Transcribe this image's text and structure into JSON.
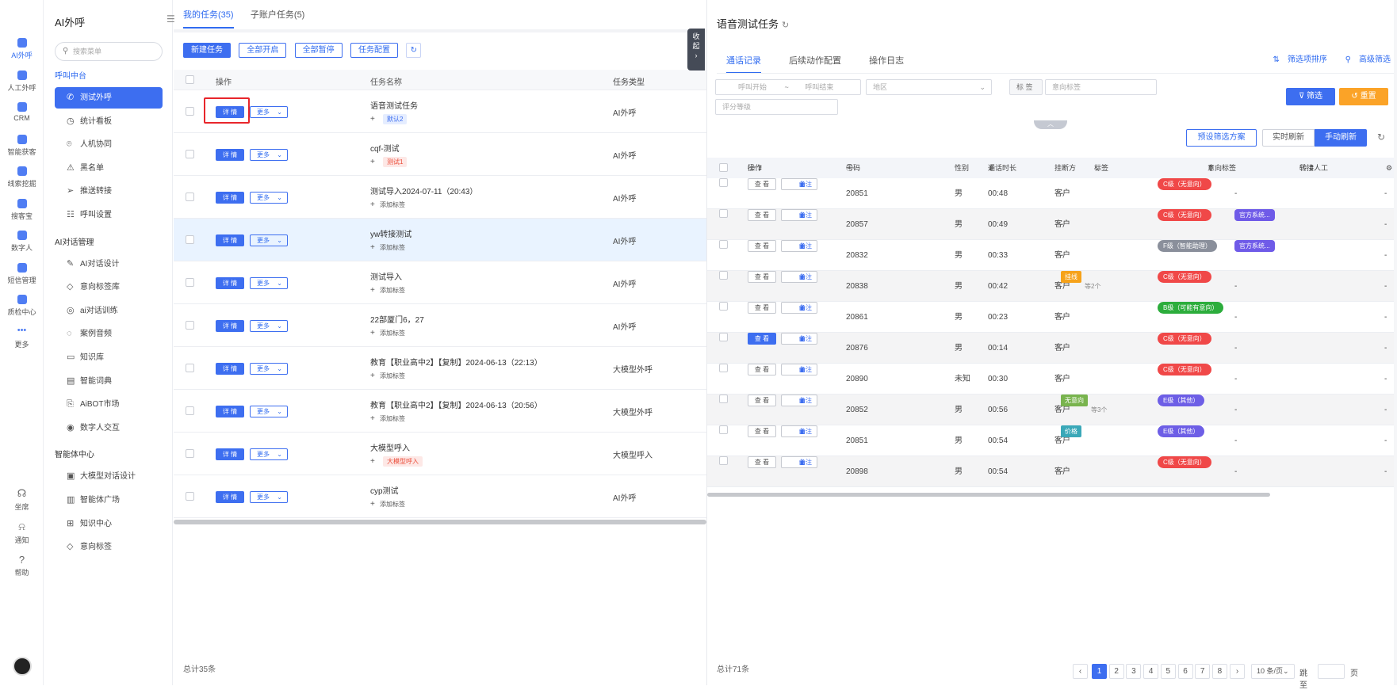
{
  "rail": {
    "items": [
      {
        "label": "AI外呼",
        "icon": "phone-robot-icon",
        "active": true
      },
      {
        "label": "人工外呼",
        "icon": "headset-icon"
      },
      {
        "label": "CRM",
        "icon": "crm-icon"
      },
      {
        "label": "智能获客",
        "icon": "target-icon"
      },
      {
        "label": "线索挖掘",
        "icon": "dig-icon"
      },
      {
        "label": "搜客宝",
        "icon": "search-box-icon"
      },
      {
        "label": "数字人",
        "icon": "digital-human-icon"
      },
      {
        "label": "短信管理",
        "icon": "sms-icon"
      },
      {
        "label": "质检中心",
        "icon": "shield-icon"
      },
      {
        "label": "更多",
        "icon": "more-dots-icon"
      }
    ],
    "bottom": [
      {
        "label": "坐席",
        "icon": "agent-icon",
        "sym": "☊"
      },
      {
        "label": "通知",
        "icon": "bell-icon",
        "sym": "🔔"
      },
      {
        "label": "帮助",
        "icon": "help-icon",
        "sym": "?"
      }
    ]
  },
  "menu": {
    "title": "AI外呼",
    "search_placeholder": "搜索菜单",
    "groups": [
      {
        "label": "呼叫中台",
        "items": [
          "测试外呼",
          "统计看板",
          "人机协同",
          "黑名单",
          "推送转接",
          "呼叫设置"
        ]
      },
      {
        "label": "AI对话管理",
        "items": [
          "AI对话设计",
          "意向标签库",
          "ai对话训练",
          "案例音频",
          "知识库",
          "智能词典",
          "AiBOT市场",
          "数字人交互"
        ]
      },
      {
        "label": "智能体中心",
        "items": [
          "大模型对话设计",
          "智能体广场",
          "知识中心",
          "意向标签"
        ]
      }
    ]
  },
  "tasks": {
    "tabs": [
      "我的任务(35)",
      "子账户任务(5)"
    ],
    "toolbar": [
      "新建任务",
      "全部开启",
      "全部暂停",
      "任务配置"
    ],
    "headers": {
      "op": "操作",
      "name": "任务名称",
      "type": "任务类型"
    },
    "detail_label": "详 情",
    "more_label": "更多",
    "rows": [
      {
        "name": "语音测试任务",
        "tag": "默认2",
        "tag_style": "blue",
        "type": "AI外呼"
      },
      {
        "name": "cqf-测试",
        "tag": "测试1",
        "tag_style": "red",
        "type": "AI外呼"
      },
      {
        "name": "测试导入2024-07-11（20:43）",
        "tag": "添加标签",
        "tag_style": "plain",
        "type": "AI外呼"
      },
      {
        "name": "yw转接测试",
        "tag": "添加标签",
        "tag_style": "plain",
        "type": "AI外呼"
      },
      {
        "name": "测试导入",
        "tag": "添加标签",
        "tag_style": "plain",
        "type": "AI外呼"
      },
      {
        "name": "22部厦门6，27",
        "tag": "添加标签",
        "tag_style": "plain",
        "type": "AI外呼"
      },
      {
        "name": "教育【职业高中2】【复制】2024-06-13（22:13）",
        "tag": "添加标签",
        "tag_style": "plain",
        "type": "大模型外呼"
      },
      {
        "name": "教育【职业高中2】【复制】2024-06-13（20:56）",
        "tag": "添加标签",
        "tag_style": "plain",
        "type": "大模型外呼"
      },
      {
        "name": "大模型呼入",
        "tag": "大模型呼入",
        "tag_style": "red",
        "type": "大模型呼入"
      },
      {
        "name": "cyp测试",
        "tag": "添加标签",
        "tag_style": "plain",
        "type": "AI外呼"
      }
    ],
    "total": "总计35条",
    "collapse_label": "收起"
  },
  "detail": {
    "title": "语音测试任务",
    "tabs": [
      "通话记录",
      "后续动作配置",
      "操作日志"
    ],
    "links": [
      "筛选项排序",
      "高级筛选"
    ],
    "filters": {
      "call_start": "呼叫开始",
      "sep": "~",
      "call_end": "呼叫结束",
      "region": "地区",
      "tag_label": "标 签",
      "intent": "意向标签",
      "score": "评分等级"
    },
    "filter_btn": "筛选",
    "reset_btn": "重置",
    "preset_btn": "预设筛选方案",
    "realtime_btn": "实时刷新",
    "manual_btn": "手动刷新",
    "headers": [
      "操作",
      "号码",
      "性别",
      "通话时长",
      "挂断方",
      "标签",
      "意向标签",
      "转接人工"
    ],
    "view_label": "查 看",
    "note_label": "备注",
    "rows": [
      {
        "num": "20851",
        "sex": "男",
        "dur": "00:48",
        "hang": "客户",
        "tag": "-",
        "tag_color": "",
        "tag_extra": "",
        "intent": "C级（无意向）",
        "intent_color": "#f04848",
        "transfer": "-",
        "viewed": false
      },
      {
        "num": "20857",
        "sex": "男",
        "dur": "00:49",
        "hang": "客户",
        "tag": "-",
        "tag_color": "",
        "tag_extra": "",
        "intent": "C级（无意向）",
        "intent_color": "#f04848",
        "transfer": "官方系统...",
        "viewed": false
      },
      {
        "num": "20832",
        "sex": "男",
        "dur": "00:33",
        "hang": "客户",
        "tag": "-",
        "tag_color": "",
        "tag_extra": "",
        "intent": "F级（智能助理）",
        "intent_color": "#8a8f9b",
        "transfer": "官方系统...",
        "viewed": false
      },
      {
        "num": "20838",
        "sex": "男",
        "dur": "00:42",
        "hang": "客户",
        "tag": "挂线",
        "tag_color": "#f6a21a",
        "tag_extra": "等2个",
        "intent": "C级（无意向）",
        "intent_color": "#f04848",
        "transfer": "-",
        "viewed": false
      },
      {
        "num": "20861",
        "sex": "男",
        "dur": "00:23",
        "hang": "客户",
        "tag": "-",
        "tag_color": "",
        "tag_extra": "",
        "intent": "B级（可能有意向）",
        "intent_color": "#2cad3c",
        "transfer": "-",
        "viewed": false
      },
      {
        "num": "20876",
        "sex": "男",
        "dur": "00:14",
        "hang": "客户",
        "tag": "-",
        "tag_color": "",
        "tag_extra": "",
        "intent": "C级（无意向）",
        "intent_color": "#f04848",
        "transfer": "-",
        "viewed": true
      },
      {
        "num": "20890",
        "sex": "未知",
        "dur": "00:30",
        "hang": "客户",
        "tag": "-",
        "tag_color": "",
        "tag_extra": "",
        "intent": "C级（无意向）",
        "intent_color": "#f04848",
        "transfer": "-",
        "viewed": false
      },
      {
        "num": "20852",
        "sex": "男",
        "dur": "00:56",
        "hang": "客户",
        "tag": "无意向",
        "tag_color": "#79b44e",
        "tag_extra": "等3个",
        "intent": "E级（其他）",
        "intent_color": "#6d5ee6",
        "transfer": "-",
        "viewed": false
      },
      {
        "num": "20851",
        "sex": "男",
        "dur": "00:54",
        "hang": "客户",
        "tag": "价格",
        "tag_color": "#3aa8b8",
        "tag_extra": "",
        "intent": "E级（其他）",
        "intent_color": "#6d5ee6",
        "transfer": "-",
        "viewed": false
      },
      {
        "num": "20898",
        "sex": "男",
        "dur": "00:54",
        "hang": "客户",
        "tag": "-",
        "tag_color": "",
        "tag_extra": "",
        "intent": "C级（无意向）",
        "intent_color": "#f04848",
        "transfer": "-",
        "viewed": false
      }
    ],
    "total": "总计71条",
    "pages": [
      "1",
      "2",
      "3",
      "4",
      "5",
      "6",
      "7",
      "8"
    ],
    "page_size": "10 条/页",
    "jump": "跳至",
    "page_suffix": "页"
  },
  "colors": {
    "accent": "#3d6ef0",
    "warning": "#fba327",
    "highlight_row": "#e9f3ff",
    "red_box": "#e8262b"
  }
}
